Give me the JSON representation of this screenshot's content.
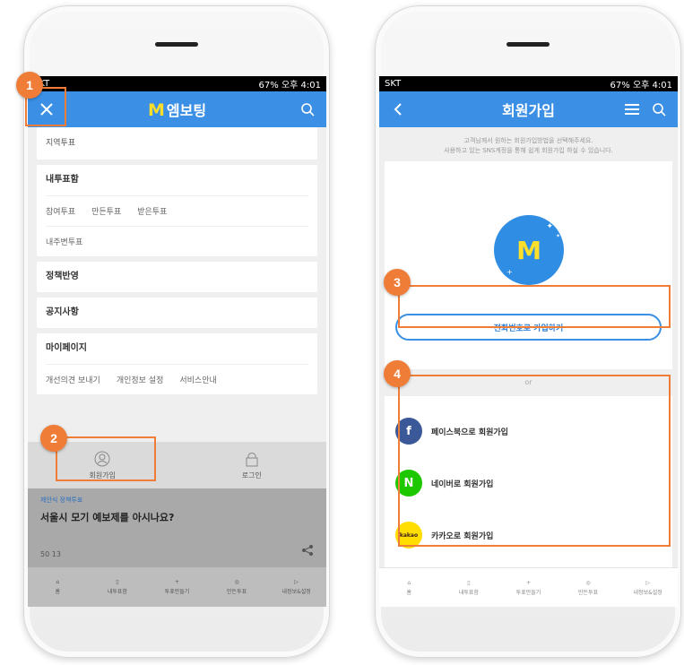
{
  "status_bar": {
    "left_carrier_left": "SKT",
    "left_carrier_right": "SKT",
    "indicators": "67%",
    "time": "오후 4:01"
  },
  "left_screen": {
    "app_title_mark": "M",
    "app_title": "엠보팅",
    "menu": {
      "regional_vote": "지역투표",
      "my_votes_head": "내투표함",
      "my_votes_items": [
        "참여투표",
        "만든투표",
        "받은투표"
      ],
      "my_hashtag_votes": "내주변투표",
      "policy": "정책반영",
      "notice": "공지사항",
      "mypage_head": "마이페이지",
      "mypage_items": [
        "개선의견 보내기",
        "개인정보 설정",
        "서비스안내"
      ]
    },
    "tabs": {
      "signup": "회원가입",
      "login": "로그인"
    },
    "news": {
      "category": "제안식 정책투표",
      "headline": "서울시 모기 예보제를 아시나요?",
      "meta": "50  13"
    },
    "nav": [
      "홈",
      "내투표함",
      "투표만들기",
      "만든투표",
      "내정보&설정"
    ]
  },
  "right_screen": {
    "title": "회원가입",
    "intro_line1": "고객님께서 원하는 회원가입방법을 선택해주세요.",
    "intro_line2": "사용하고 있는 SNS계정을 통해 쉽게 회원가입 하실 수 있습니다.",
    "logo_mark": "M",
    "phone_signup": "전화번호로 가입하기",
    "or": "or",
    "social": [
      {
        "icon_text": "f",
        "label": "페이스북으로 회원가입",
        "color": "#3b5998"
      },
      {
        "icon_text": "N",
        "label": "네이버로 회원가입",
        "color": "#1ec800"
      },
      {
        "icon_text": "kakao",
        "label": "카카오로 회원가입",
        "color": "#ffde00"
      }
    ],
    "nav": [
      "홈",
      "내투표함",
      "투표만들기",
      "만든투표",
      "내정보&설정"
    ]
  },
  "annotations": [
    "1",
    "2",
    "3",
    "4"
  ],
  "colors": {
    "brand_blue": "#3b8fe4",
    "accent_yellow": "#ffdf2a",
    "annotation_orange": "#ef7d38"
  }
}
